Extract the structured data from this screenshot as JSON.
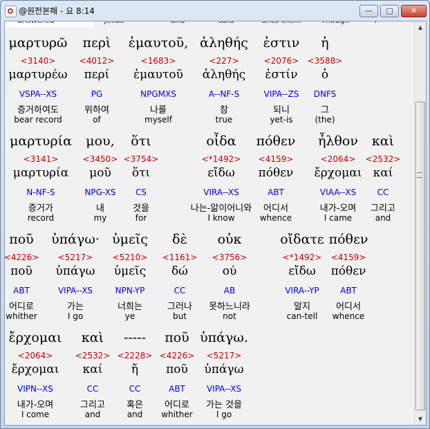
{
  "window": {
    "title": "@원전본해 - 요 8:14",
    "minimize_glyph": "—",
    "maximize_glyph": "□",
    "close_glyph": "✕"
  },
  "scrollbar": {
    "up_glyph": "▲",
    "down_glyph": "▼"
  },
  "prev_caption": [
    "answered",
    "Jesus",
    "and",
    "said",
    "unto them",
    "Though",
    "I"
  ],
  "lines": [
    {
      "words": [
        {
          "greek": "μαρτυρῶ",
          "strong": "<3140>",
          "lemma": "μαρτυρέω",
          "morph": "VSPA--XS",
          "ko": "증거하여도",
          "en": "bear record"
        },
        {
          "greek": "περὶ",
          "strong": "<4012>",
          "lemma": "περί",
          "morph": "PG",
          "ko": "위하여",
          "en": "of"
        },
        {
          "greek": "ἐμαυτοῦ,",
          "strong": "<1683>",
          "lemma": "ἐμαυτοῦ",
          "morph": "NPGMXS",
          "ko": "나를",
          "en": "myself"
        },
        {
          "greek": "ἀληθής",
          "strong": "<227>",
          "lemma": "ἀληθής",
          "morph": "A--NF-S",
          "ko": "참",
          "en": "true"
        },
        {
          "greek": "ἐστιν",
          "strong": "<2076>",
          "lemma": "ἐστίν",
          "morph": "VIPA--ZS",
          "ko": "되니",
          "en": "yet-is"
        },
        {
          "greek": "ἡ",
          "strong": "<3588>",
          "lemma": "ὁ",
          "morph": "DNFS",
          "ko": "그",
          "en": "(the)"
        }
      ]
    },
    {
      "words": [
        {
          "greek": "μαρτυρία",
          "strong": "<3141>",
          "lemma": "μαρτυρία",
          "morph": "N-NF-S",
          "ko": "증거가",
          "en": "record"
        },
        {
          "greek": "μου,",
          "strong": "<3450>",
          "lemma": "μοῦ",
          "morph": "NPG-XS",
          "ko": "내",
          "en": "my"
        },
        {
          "greek": "ὅτι",
          "strong": "<3754>",
          "lemma": "ὅτι",
          "morph": "CS",
          "ko": "것을",
          "en": "for"
        },
        {
          "greek": "οἶδα",
          "strong": "<*1492>",
          "lemma": "εἴδω",
          "morph": "VIRA--XS",
          "ko": "나는-앎이어니와",
          "en": "I know"
        },
        {
          "greek": "πόθεν",
          "strong": "<4159>",
          "lemma": "πόθεν",
          "morph": "ABT",
          "ko": "어디서",
          "en": "whence"
        },
        {
          "greek": "ἦλθον",
          "strong": "<2064>",
          "lemma": "ἔρχομαι",
          "morph": "VIAA--XS",
          "ko": "내가-오며",
          "en": "I came"
        },
        {
          "greek": "καὶ",
          "strong": "<2532>",
          "lemma": "καί",
          "morph": "CC",
          "ko": "그리고",
          "en": "and"
        }
      ]
    },
    {
      "words": [
        {
          "greek": "ποῦ",
          "strong": "<4226>",
          "lemma": "ποῦ",
          "morph": "ABT",
          "ko": "어디로",
          "en": "whither"
        },
        {
          "greek": "ὑπάγω·",
          "strong": "<5217>",
          "lemma": "ὑπάγω",
          "morph": "VIPA--XS",
          "ko": "가는",
          "en": "I go"
        },
        {
          "greek": "ὑμεῖς",
          "strong": "<5210>",
          "lemma": "ὑμεῖς",
          "morph": "NPN-YP",
          "ko": "너희는",
          "en": "ye"
        },
        {
          "greek": "δὲ",
          "strong": "<1161>",
          "lemma": "δώ",
          "morph": "CC",
          "ko": "그러나",
          "en": "but"
        },
        {
          "greek": "οὐκ",
          "strong": "<3756>",
          "lemma": "ού",
          "morph": "AB",
          "ko": "못하느니라",
          "en": "not"
        },
        {
          "greek": "οἴδατε",
          "strong": "<*1492>",
          "lemma": "εἴδω",
          "morph": "VIRA--YP",
          "ko": "알지",
          "en": "can-tell"
        },
        {
          "greek": "πόθεν",
          "strong": "<4159>",
          "lemma": "πόθεν",
          "morph": "ABT",
          "ko": "어디서",
          "en": "whence"
        }
      ]
    },
    {
      "words": [
        {
          "greek": "ἔρχομαι",
          "strong": "<2064>",
          "lemma": "ἔρχομαι",
          "morph": "VIPN--XS",
          "ko": "내가-오며",
          "en": "I come"
        },
        {
          "greek": "καὶ",
          "strong": "<2532>",
          "lemma": "καί",
          "morph": "CC",
          "ko": "그리고",
          "en": "and"
        },
        {
          "greek": "-----",
          "strong": "<2228>",
          "lemma": "ἤ",
          "morph": "CC",
          "ko": "혹은",
          "en": "and"
        },
        {
          "greek": "ποῦ",
          "strong": "<4226>",
          "lemma": "ποῦ",
          "morph": "ABT",
          "ko": "어디로",
          "en": "whither"
        },
        {
          "greek": "ὑπάγω.",
          "strong": "<5217>",
          "lemma": "ὑπάγω",
          "morph": "VIPA--XS",
          "ko": "가는 것을",
          "en": "I go"
        }
      ]
    }
  ]
}
